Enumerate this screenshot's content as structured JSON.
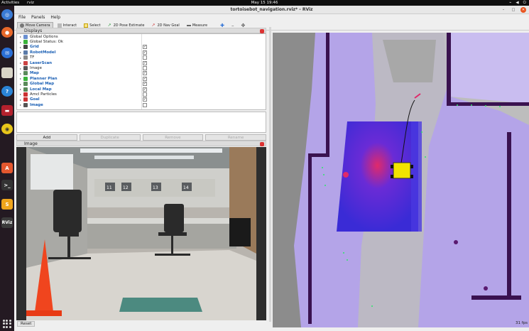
{
  "topbar": {
    "activities": "Activities",
    "app_name": "rviz",
    "clock": "May 15  19:46",
    "tray_icons": [
      "network-icon",
      "volume-icon",
      "power-icon"
    ]
  },
  "dock": {
    "icons": [
      "chromium-icon",
      "firefox-icon",
      "thunderbird-icon",
      "files-icon",
      "help-icon",
      "terminal-red-icon",
      "rhythmbox-icon",
      "software-center-icon",
      "terminal-icon",
      "sublime-icon",
      "rviz-icon",
      "show-apps-icon"
    ]
  },
  "window": {
    "title": "tortoisebot_navigation.rviz* - RViz"
  },
  "menu": [
    "File",
    "Panels",
    "Help"
  ],
  "toolbar": {
    "move_camera": "Move Camera",
    "interact": "Interact",
    "select": "Select",
    "pose_estimate": "2D Pose Estimate",
    "nav_goal": "2D Nav Goal",
    "measure": "Measure"
  },
  "displays": {
    "title": "Displays",
    "rows": [
      {
        "name": "Global Options",
        "blue": false,
        "check": null,
        "icon": "gear-icon"
      },
      {
        "name": "Global Status: Ok",
        "blue": false,
        "check": null,
        "icon": "status-ok-icon"
      },
      {
        "name": "Grid",
        "blue": true,
        "check": true,
        "icon": "grid-icon"
      },
      {
        "name": "RobotModel",
        "blue": true,
        "check": true,
        "icon": "robot-icon"
      },
      {
        "name": "TF",
        "blue": false,
        "check": false,
        "icon": "tf-icon"
      },
      {
        "name": "LaserScan",
        "blue": true,
        "check": true,
        "icon": "laser-icon"
      },
      {
        "name": "Image",
        "blue": false,
        "check": false,
        "icon": "image-icon"
      },
      {
        "name": "Map",
        "blue": true,
        "check": true,
        "icon": "map-icon"
      },
      {
        "name": "Planner Plan",
        "blue": true,
        "check": true,
        "icon": "path-icon"
      },
      {
        "name": "Global Map",
        "blue": true,
        "check": true,
        "icon": "map-icon"
      },
      {
        "name": "Local Map",
        "blue": true,
        "check": true,
        "icon": "map-icon"
      },
      {
        "name": "Amcl Particles",
        "blue": false,
        "check": false,
        "icon": "particles-icon"
      },
      {
        "name": "Goal",
        "blue": true,
        "check": true,
        "icon": "goal-icon"
      },
      {
        "name": "Image",
        "blue": true,
        "check": false,
        "icon": "image-icon"
      }
    ],
    "buttons": {
      "add": "Add",
      "duplicate": "Duplicate",
      "remove": "Remove",
      "rename": "Rename"
    }
  },
  "image_panel": {
    "title": "Image",
    "room_numbers": [
      "11",
      "12",
      "13",
      "14"
    ]
  },
  "bottom": {
    "reset": "Reset",
    "fps": "31 fps"
  },
  "colors": {
    "costmap_purple": "#b4a4e8",
    "costmap_blue": "#3a2bd6",
    "lethal_red": "#e02a6a",
    "wall_dark": "#3a1250",
    "robot_yellow": "#f2e400",
    "laser_green": "#2de66a"
  }
}
